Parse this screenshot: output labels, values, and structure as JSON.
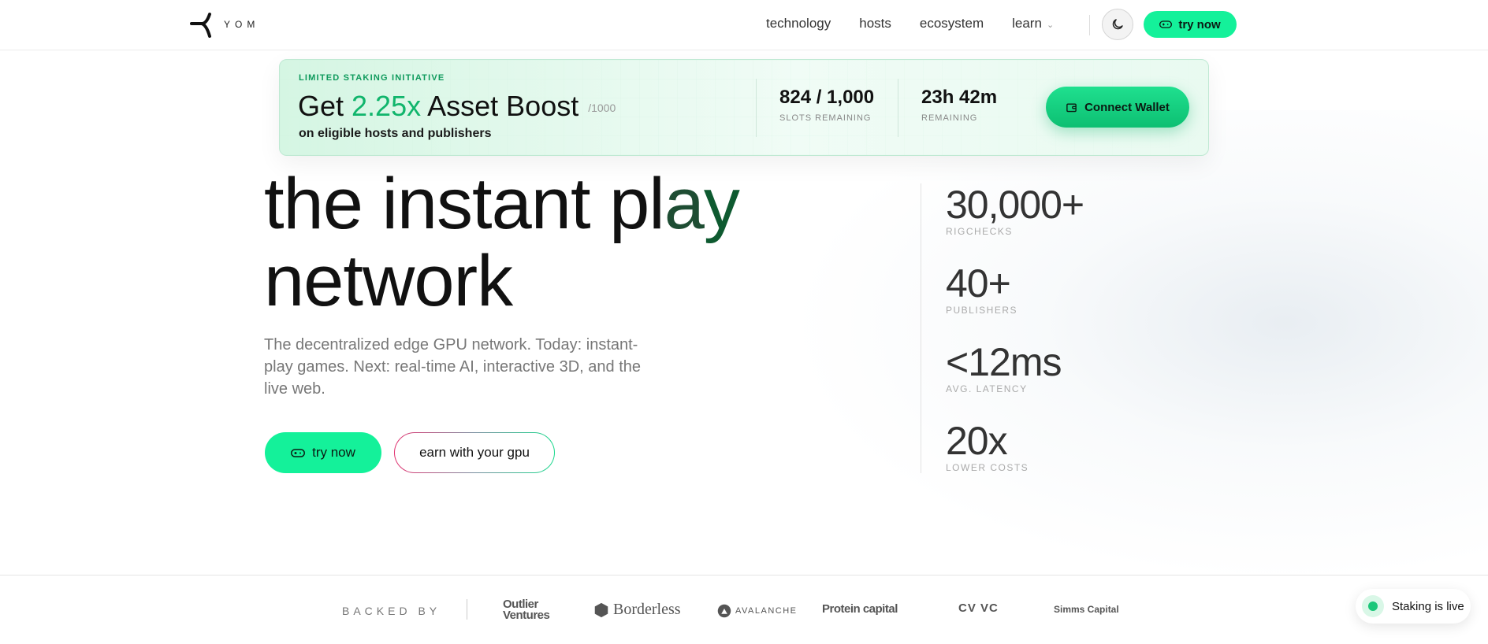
{
  "nav": {
    "brand": "YOM",
    "links": [
      "technology",
      "hosts",
      "ecosystem",
      "learn"
    ],
    "try_label": "try now"
  },
  "promo": {
    "kicker": "LIMITED STAKING INITIATIVE",
    "title_prefix": "Get ",
    "title_accent": "2.25x",
    "title_suffix": " Asset Boost",
    "denominator": "/1000",
    "subtitle": "on eligible hosts and publishers",
    "slots_value": "824 / 1,000",
    "slots_label": "SLOTS REMAINING",
    "time_value": "23h 42m",
    "time_label": "REMAINING",
    "connect_label": "Connect Wallet"
  },
  "hero": {
    "title_line1_a": "the instant pl",
    "title_line1_b": "a",
    "title_line1_c": "y",
    "title_line2": "network",
    "description": "The decentralized edge GPU network. Today: instant-play games. Next: real-time AI, interactive 3D, and the live web.",
    "try_label": "try now",
    "earn_label": "earn with your gpu"
  },
  "stats": [
    {
      "value": "30,000+",
      "label": "RIGCHECKS"
    },
    {
      "value": "40+",
      "label": "PUBLISHERS"
    },
    {
      "value": "<12ms",
      "label": "AVG. LATENCY"
    },
    {
      "value": "20x",
      "label": "LOWER COSTS"
    }
  ],
  "backed": {
    "label": "BACKED BY",
    "backers": [
      "Outlier Ventures",
      "Borderless",
      "AVALANCHE",
      "Protein capital",
      "CV VC",
      "Simms Capital"
    ]
  },
  "toast": {
    "text": "Staking is live"
  },
  "colors": {
    "accent": "#14f19a",
    "accent_dark": "#10b56c"
  }
}
